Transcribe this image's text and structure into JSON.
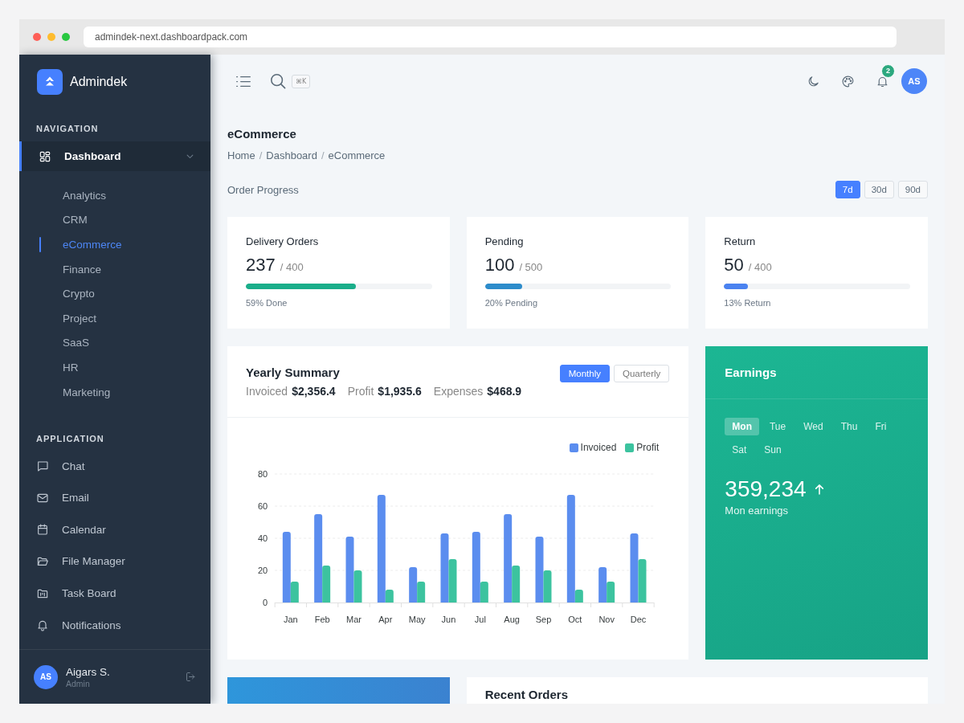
{
  "browser": {
    "url": "admindek-next.dashboardpack.com"
  },
  "sidebar": {
    "brand": "Admindek",
    "sections": [
      {
        "title": "NAVIGATION",
        "items": [
          {
            "label": "Dashboard",
            "selected": true,
            "expanded": true,
            "children": [
              {
                "label": "Analytics",
                "selected": false
              },
              {
                "label": "CRM",
                "selected": false
              },
              {
                "label": "eCommerce",
                "selected": true
              },
              {
                "label": "Finance",
                "selected": false
              },
              {
                "label": "Crypto",
                "selected": false
              },
              {
                "label": "Project",
                "selected": false
              },
              {
                "label": "SaaS",
                "selected": false
              },
              {
                "label": "HR",
                "selected": false
              },
              {
                "label": "Marketing",
                "selected": false
              }
            ]
          }
        ]
      },
      {
        "title": "APPLICATION",
        "items": [
          {
            "label": "Chat",
            "selected": false
          },
          {
            "label": "Email",
            "selected": false
          },
          {
            "label": "Calendar",
            "selected": false
          },
          {
            "label": "File Manager",
            "selected": false
          },
          {
            "label": "Task Board",
            "selected": false
          },
          {
            "label": "Notifications",
            "selected": false
          }
        ]
      }
    ],
    "user": {
      "initials": "AS",
      "name": "Aigars S.",
      "role": "Admin"
    }
  },
  "header": {
    "search_shortcut": "⌘K",
    "notifications": "2",
    "avatar": "AS"
  },
  "page": {
    "title": "eCommerce",
    "breadcrumb": [
      {
        "label": "Home"
      },
      {
        "separator": "/",
        "label": "Dashboard"
      },
      {
        "separator": "/",
        "label": "eCommerce"
      }
    ]
  },
  "order_progress": {
    "title": "Order Progress",
    "ranges": [
      {
        "label": "7d",
        "selected": true
      },
      {
        "label": "30d",
        "selected": false
      },
      {
        "label": "90d",
        "selected": false
      }
    ],
    "cards": [
      {
        "title": "Delivery Orders",
        "value": "237",
        "total": "/ 400",
        "level": 0.59,
        "color": "#1aae8a",
        "caption": "59% Done"
      },
      {
        "title": "Pending",
        "value": "100",
        "total": "/ 500",
        "level": 0.2,
        "color": "#2d8ccb",
        "caption": "20% Pending"
      },
      {
        "title": "Return",
        "value": "50",
        "total": "/ 400",
        "level": 0.13,
        "color": "#4a82f0",
        "caption": "13% Return"
      }
    ]
  },
  "yearly_summary": {
    "title": "Yearly Summary",
    "stats": [
      {
        "label": "Invoiced",
        "value": "$2,356.4"
      },
      {
        "label": "Profit",
        "value": "$1,935.6"
      },
      {
        "label": "Expenses",
        "value": "$468.9"
      }
    ],
    "periods": [
      {
        "label": "Monthly",
        "selected": true
      },
      {
        "label": "Quarterly",
        "selected": false
      }
    ],
    "chart_data": {
      "type": "bar",
      "categories": [
        "Jan",
        "Feb",
        "Mar",
        "Apr",
        "May",
        "Jun",
        "Jul",
        "Aug",
        "Sep",
        "Oct",
        "Nov",
        "Dec"
      ],
      "series": [
        {
          "name": "Invoiced",
          "color": "#5b8def",
          "values": [
            44,
            55,
            41,
            67,
            22,
            43,
            44,
            55,
            41,
            67,
            22,
            43
          ]
        },
        {
          "name": "Profit",
          "color": "#3cc39f",
          "values": [
            13,
            23,
            20,
            8,
            13,
            27,
            13,
            23,
            20,
            8,
            13,
            27
          ]
        }
      ],
      "ylim": [
        0,
        80
      ],
      "yticks": [
        0,
        20,
        40,
        60,
        80
      ],
      "grid": true,
      "legend": "top-right"
    }
  },
  "earnings": {
    "title": "Earnings",
    "days": [
      {
        "label": "Mon",
        "selected": true
      },
      {
        "label": "Tue",
        "selected": false
      },
      {
        "label": "Wed",
        "selected": false
      },
      {
        "label": "Thu",
        "selected": false
      },
      {
        "label": "Fri",
        "selected": false
      },
      {
        "label": "Sat",
        "selected": false
      },
      {
        "label": "Sun",
        "selected": false
      }
    ],
    "amount": "359,234",
    "caption": "Mon earnings"
  },
  "recent_orders": {
    "title": "Recent Orders"
  }
}
